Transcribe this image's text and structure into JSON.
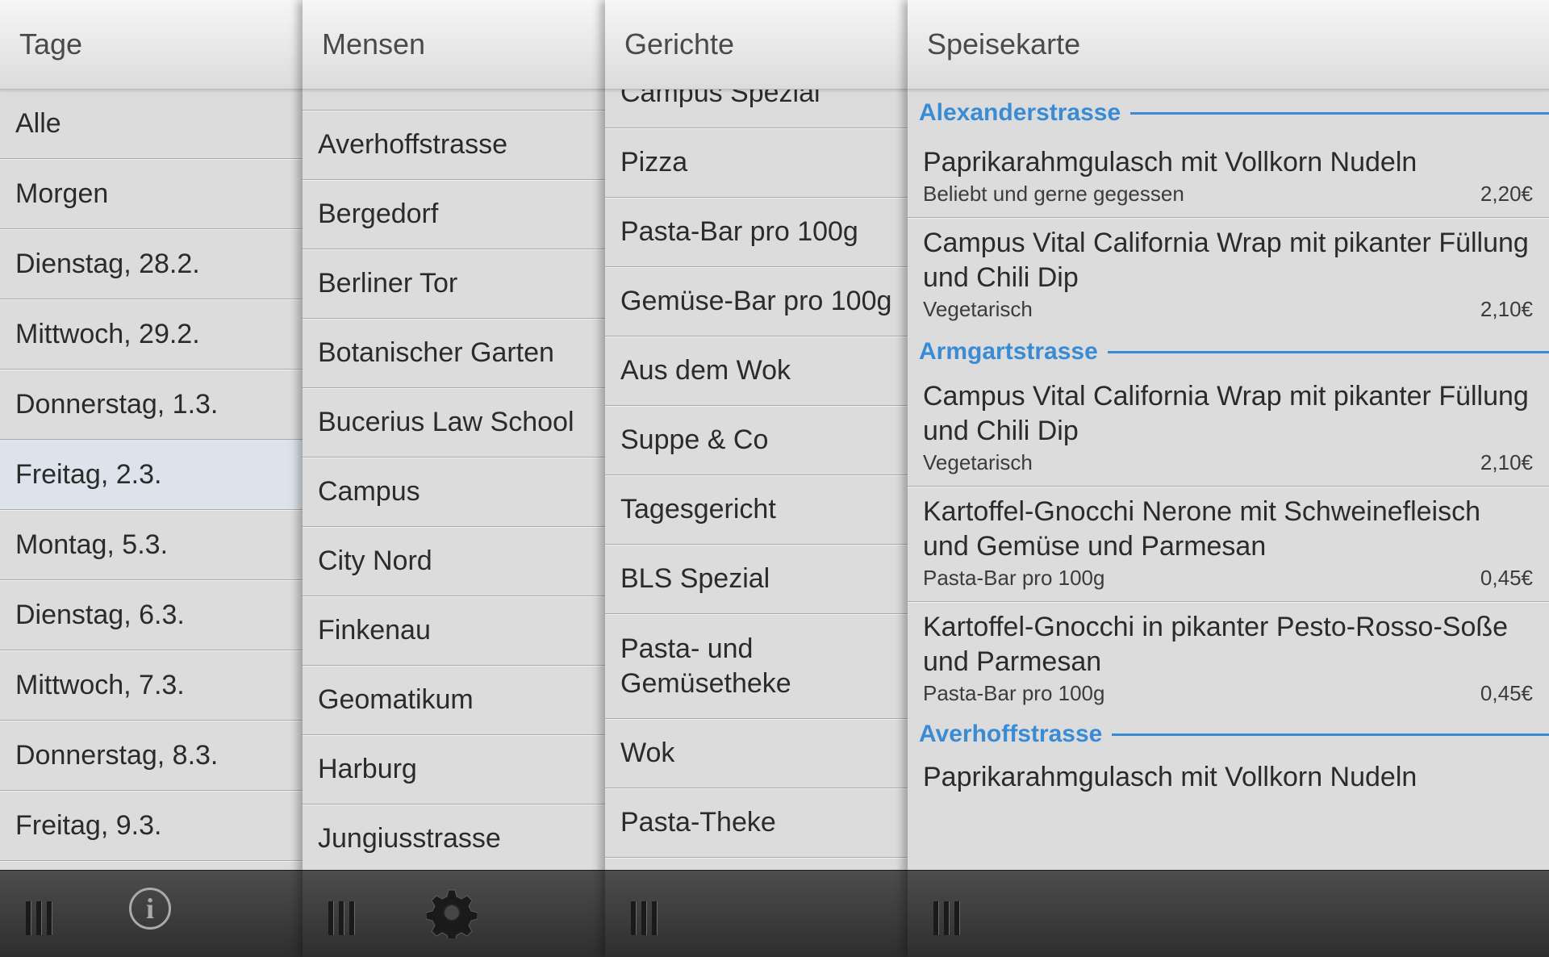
{
  "tage": {
    "title": "Tage",
    "items": [
      "Alle",
      "Morgen",
      "Dienstag, 28.2.",
      "Mittwoch, 29.2.",
      "Donnerstag, 1.3.",
      "Freitag, 2.3.",
      "Montag, 5.3.",
      "Dienstag, 6.3.",
      "Mittwoch, 7.3.",
      "Donnerstag, 8.3.",
      "Freitag, 9.3."
    ],
    "selected_index": 5
  },
  "mensen": {
    "title": "Mensen",
    "items": [
      "Averhoffstrasse",
      "Bergedorf",
      "Berliner Tor",
      "Botanischer Garten",
      "Bucerius Law School",
      "Campus",
      "City Nord",
      "Finkenau",
      "Geomatikum",
      "Harburg",
      "Jungiusstrasse"
    ]
  },
  "gerichte": {
    "title": "Gerichte",
    "items": [
      "Campus Spezial",
      "Pizza",
      "Pasta-Bar pro 100g",
      "Gemüse-Bar pro 100g",
      "Aus dem Wok",
      "Suppe & Co",
      "Tagesgericht",
      "BLS Spezial",
      "Pasta- und Gemüsetheke",
      "Wok",
      "Pasta-Theke"
    ]
  },
  "speisekarte": {
    "title": "Speisekarte",
    "sections": [
      {
        "name": "Alexanderstrasse",
        "dishes": [
          {
            "title": "Paprikarahmgulasch mit Vollkorn Nudeln",
            "category": "Beliebt und gerne gegessen",
            "price": "2,20€"
          },
          {
            "title": "Campus Vital California Wrap mit pikanter Füllung und Chili Dip",
            "category": "Vegetarisch",
            "price": "2,10€"
          }
        ]
      },
      {
        "name": "Armgartstrasse",
        "dishes": [
          {
            "title": "Campus Vital California Wrap mit pikanter Füllung und Chili Dip",
            "category": "Vegetarisch",
            "price": "2,10€"
          },
          {
            "title": "Kartoffel-Gnocchi Nerone mit Schweinefleisch und Gemüse und Parmesan",
            "category": "Pasta-Bar pro 100g",
            "price": "0,45€"
          },
          {
            "title": "Kartoffel-Gnocchi in pikanter Pesto-Rosso-Soße und Parmesan",
            "category": "Pasta-Bar pro 100g",
            "price": "0,45€"
          }
        ]
      },
      {
        "name": "Averhoffstrasse",
        "dishes": [
          {
            "title": "Paprikarahmgulasch mit Vollkorn Nudeln",
            "category": "",
            "price": ""
          }
        ]
      }
    ]
  },
  "footer": {
    "grip_icon": "grip-icon",
    "info_icon": "info-icon",
    "info_glyph": "i",
    "settings_icon": "gear-icon"
  },
  "colors": {
    "accent": "#3a8bd6",
    "selected_row": "#dde3ea",
    "footer": "#3a3a3a"
  }
}
